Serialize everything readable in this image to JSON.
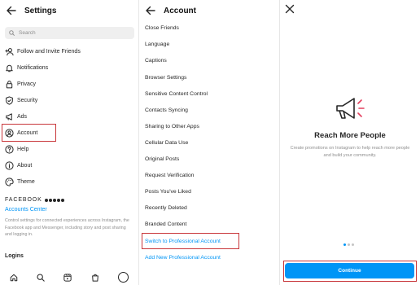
{
  "settings": {
    "title": "Settings",
    "search_placeholder": "Search",
    "items": [
      {
        "label": "Follow and Invite Friends",
        "icon": "add-person-icon"
      },
      {
        "label": "Notifications",
        "icon": "bell-icon"
      },
      {
        "label": "Privacy",
        "icon": "lock-icon"
      },
      {
        "label": "Security",
        "icon": "shield-icon"
      },
      {
        "label": "Ads",
        "icon": "megaphone-icon"
      },
      {
        "label": "Account",
        "icon": "account-circle-icon"
      },
      {
        "label": "Help",
        "icon": "help-circle-icon"
      },
      {
        "label": "About",
        "icon": "info-icon"
      },
      {
        "label": "Theme",
        "icon": "palette-icon"
      }
    ],
    "facebook_label": "FACEBOOK",
    "accounts_center": "Accounts Center",
    "accounts_center_desc": "Control settings for connected experiences across Instagram, the Facebook app and Messenger, including story and post sharing and logging in.",
    "logins": "Logins"
  },
  "account": {
    "title": "Account",
    "items": [
      "Close Friends",
      "Language",
      "Captions",
      "Browser Settings",
      "Sensitive Content Control",
      "Contacts Syncing",
      "Sharing to Other Apps",
      "Cellular Data Use",
      "Original Posts",
      "Request Verification",
      "Posts You've Liked",
      "Recently Deleted",
      "Branded Content",
      "Switch to Professional Account",
      "Add New Professional Account"
    ]
  },
  "promo": {
    "title": "Reach More People",
    "description": "Create promotions on Instagram to help reach more people and build your community.",
    "continue_label": "Continue"
  },
  "colors": {
    "accent": "#0095f6",
    "highlight": "#c8363a"
  }
}
